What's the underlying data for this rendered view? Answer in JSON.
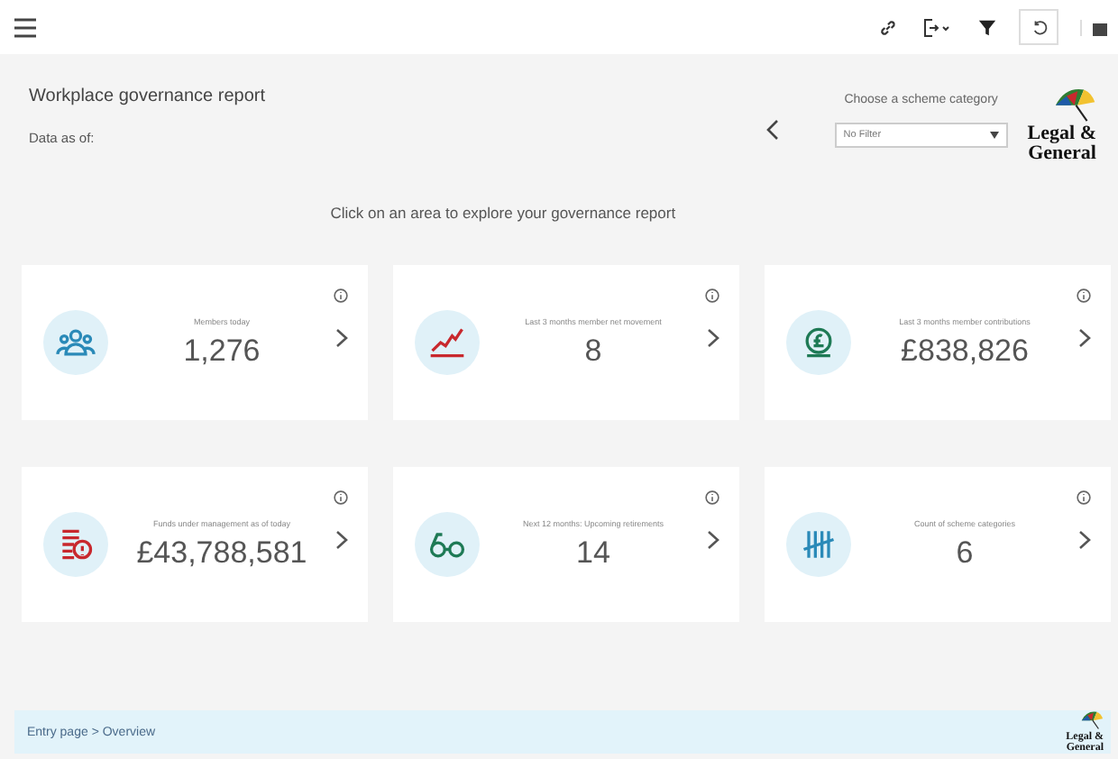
{
  "header": {
    "title": "Workplace governance report",
    "data_as_of": "Data as of:",
    "instruction": "Click on an area to explore your governance report"
  },
  "filter": {
    "label": "Choose a scheme category",
    "value": "No Filter"
  },
  "logos": [
    {
      "line1": "Legal &",
      "line2": "General"
    }
  ],
  "cards": [
    {
      "kind": "people",
      "color": "#2a8ab8",
      "label": "Members today",
      "value": "1,276"
    },
    {
      "kind": "growth",
      "color": "#c8282d",
      "label": "Last 3 months member net movement",
      "value": "8"
    },
    {
      "kind": "coin",
      "color": "#1e7a55",
      "label": "Last 3 months member contributions",
      "value": "£838,826"
    },
    {
      "kind": "funds",
      "color": "#c8282d",
      "label": "Funds under management as of today",
      "value": "£43,788,581"
    },
    {
      "kind": "glasses",
      "color": "#1e7a55",
      "label": "Next 12 months: Upcoming retirements",
      "value": "14"
    },
    {
      "kind": "tally",
      "color": "#2a8ab8",
      "label": "Count of scheme categories",
      "value": "6"
    }
  ],
  "breadcrumb": [
    "Entry page",
    "Overview"
  ],
  "breadcrumb_separator": ">",
  "footer_logo": {
    "line1": "Legal &",
    "line2": "General"
  }
}
